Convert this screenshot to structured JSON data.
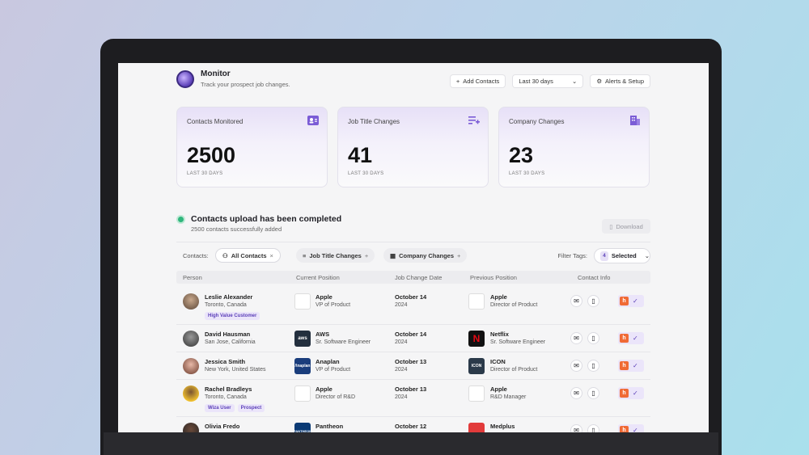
{
  "app": {
    "title": "Monitor",
    "subtitle": "Track your prospect job changes."
  },
  "toolbar": {
    "add_contacts": "Add Contacts",
    "date_range": "Last 30 days",
    "alerts_setup": "Alerts & Setup"
  },
  "stats": [
    {
      "label": "Contacts Monitored",
      "value": "2500",
      "period": "LAST 30 DAYS",
      "icon": "contacts-card-icon"
    },
    {
      "label": "Job Title Changes",
      "value": "41",
      "period": "LAST 30 DAYS",
      "icon": "list-add-icon"
    },
    {
      "label": "Company Changes",
      "value": "23",
      "period": "LAST 30 DAYS",
      "icon": "building-icon"
    }
  ],
  "upload": {
    "title": "Contacts upload has been completed",
    "subtitle": "2500 contacts successfully added",
    "download": "Download"
  },
  "filters": {
    "label": "Contacts:",
    "chips": [
      "All Contacts",
      "Job Title Changes",
      "Company Changes"
    ],
    "tags_label": "Filter Tags:",
    "tags_count": "4",
    "tags_value": "Selected"
  },
  "table": {
    "headers": [
      "Person",
      "Current Position",
      "Job Change Date",
      "Previous Position",
      "Contact Info"
    ],
    "rows": [
      {
        "name": "Leslie Alexander",
        "location": "Toronto, Canada",
        "tags": [
          "High Value Customer"
        ],
        "current_company": "Apple",
        "current_title": "VP of Product",
        "date": "October 14",
        "year": "2024",
        "previous_company": "Apple",
        "previous_title": "Director of Product"
      },
      {
        "name": "David Hausman",
        "location": "San Jose, California",
        "tags": [],
        "current_company": "AWS",
        "current_title": "Sr. Software Engineer",
        "date": "October 14",
        "year": "2024",
        "previous_company": "Netflix",
        "previous_title": "Sr. Software Engineer"
      },
      {
        "name": "Jessica Smith",
        "location": "New York, United States",
        "tags": [],
        "current_company": "Anaplan",
        "current_title": "VP of Product",
        "date": "October 13",
        "year": "2024",
        "previous_company": "ICON",
        "previous_title": "Director of Product"
      },
      {
        "name": "Rachel Bradleys",
        "location": "Toronto, Canada",
        "tags": [
          "Wiza User",
          "Prospect"
        ],
        "current_company": "Apple",
        "current_title": "Director of R&D",
        "date": "October 13",
        "year": "2024",
        "previous_company": "Apple",
        "previous_title": "R&D Manager"
      },
      {
        "name": "Olivia Fredo",
        "location": "",
        "tags": [],
        "current_company": "Pantheon",
        "current_title": "",
        "date": "October 12",
        "year": "",
        "previous_company": "Medplus",
        "previous_title": ""
      }
    ]
  },
  "logos": {
    "aws": "aws",
    "anaplan": "/\\naplan",
    "icon": "ICON",
    "pantheon": "PANTHEON"
  },
  "colors": {
    "accent": "#5b3fb8",
    "hubspot": "#f06a35",
    "success": "#2fb67c"
  }
}
